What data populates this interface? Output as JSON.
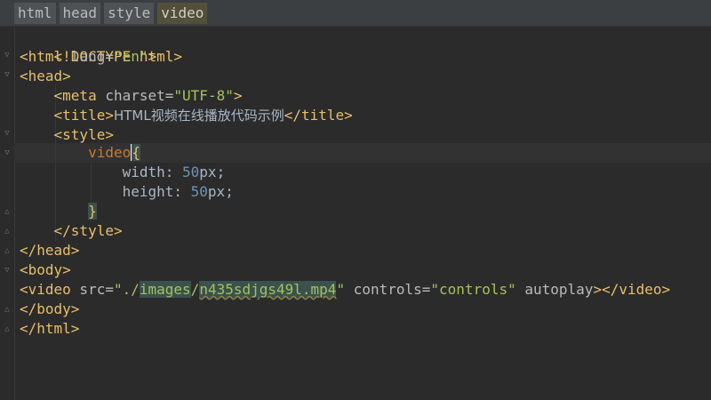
{
  "breadcrumb": [
    "html",
    "head",
    "style",
    "video"
  ],
  "code": {
    "l1": "<!DOCTYPE html>",
    "l2_tag_open": "<html",
    "l2_attr": " lang=",
    "l2_val": "\"en\"",
    "l2_close": ">",
    "l3": "<head>",
    "l4_tag": "<meta",
    "l4_attr": " charset=",
    "l4_val": "\"UTF-8\"",
    "l4_close": ">",
    "l5_open": "<title>",
    "l5_text": "HTML视频在线播放代码示例",
    "l5_close": "</title>",
    "l6": "<style>",
    "l7_sel": "video",
    "l7_brace": "{",
    "l8_prop": "width: ",
    "l8_num": "50",
    "l8_unit": "px;",
    "l9_prop": "height: ",
    "l9_num": "50",
    "l9_unit": "px;",
    "l10": "}",
    "l11": "</style>",
    "l12": "</head>",
    "l13": "<body>",
    "l14_tag": "<video",
    "l14_attr_src": " src=",
    "l14_q1": "\"./",
    "l14_images": "images",
    "l14_slash": "/",
    "l14_file": "n435sdjgs49l.mp4",
    "l14_q2": "\"",
    "l14_attr_controls": " controls=",
    "l14_val_controls": "\"controls\"",
    "l14_autoplay": " autoplay",
    "l14_end": "></video>",
    "l15": "</body>",
    "l16": "</html>"
  }
}
